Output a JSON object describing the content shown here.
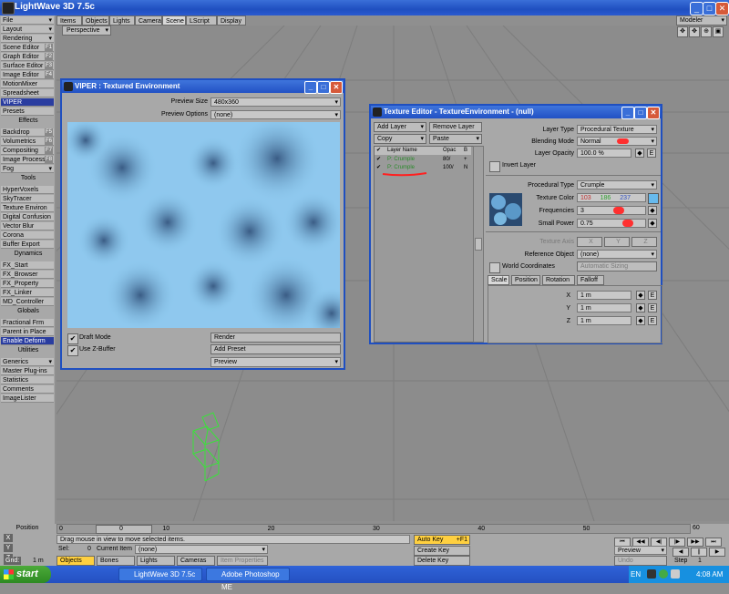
{
  "app": {
    "title": "LightWave 3D 7.5c"
  },
  "left_panel": [
    {
      "label": "File",
      "type": "dd"
    },
    {
      "label": "Layout",
      "type": "dd"
    },
    {
      "label": "Rendering",
      "type": "dd"
    },
    {
      "label": "Scene Editor",
      "sc": "F1"
    },
    {
      "label": "Graph Editor",
      "sc": "F2"
    },
    {
      "label": "Surface Editor",
      "sc": "F3"
    },
    {
      "label": "Image Editor",
      "sc": "F4"
    },
    {
      "label": "MotionMixer"
    },
    {
      "label": "Spreadsheet"
    },
    {
      "label": "VIPER",
      "type": "hl"
    },
    {
      "label": "Presets"
    },
    {
      "label": "Effects",
      "type": "hdr"
    },
    {
      "label": "Backdrop",
      "sc": "F5"
    },
    {
      "label": "Volumetrics",
      "sc": "F6"
    },
    {
      "label": "Compositing",
      "sc": "F7"
    },
    {
      "label": "Image Process",
      "sc": "F8"
    },
    {
      "label": "Fog",
      "type": "dd"
    },
    {
      "label": "Tools",
      "type": "hdr"
    },
    {
      "label": "HyperVoxels"
    },
    {
      "label": "SkyTracer"
    },
    {
      "label": "Texture Environ"
    },
    {
      "label": "Digital Confusion"
    },
    {
      "label": "Vector Blur"
    },
    {
      "label": "Corona"
    },
    {
      "label": "Buffer Export"
    },
    {
      "label": "Dynamics",
      "type": "hdr"
    },
    {
      "label": "FX_Start"
    },
    {
      "label": "FX_Browser"
    },
    {
      "label": "FX_Property"
    },
    {
      "label": "FX_Linker"
    },
    {
      "label": "MD_Controller"
    },
    {
      "label": "Globals",
      "type": "hdr"
    },
    {
      "label": "Fractional Frm"
    },
    {
      "label": "Parent in Place"
    },
    {
      "label": "Enable Deform",
      "type": "hl"
    },
    {
      "label": "Utilities",
      "type": "hdr"
    },
    {
      "label": "Generics",
      "type": "dd"
    },
    {
      "label": "Master Plug-ins"
    },
    {
      "label": "Statistics"
    },
    {
      "label": "Comments"
    },
    {
      "label": "ImageLister"
    }
  ],
  "tabs": [
    "Items",
    "Objects",
    "Lights",
    "Camera",
    "Scene",
    "LScript",
    "Display"
  ],
  "active_tab": "Scene",
  "modeler_label": "Modeler",
  "viewport": {
    "mode": "Perspective"
  },
  "viper": {
    "title": "VIPER : Textured Environment",
    "preview_size_label": "Preview Size",
    "preview_size": "480x360",
    "preview_options_label": "Preview Options",
    "preview_options": "(none)",
    "draft_mode": "Draft Mode",
    "use_zbuffer": "Use Z-Buffer",
    "render": "Render",
    "add_preset": "Add Preset",
    "preview": "Preview"
  },
  "texture_editor": {
    "title": "Texture Editor - TextureEnvironment - (null)",
    "add_layer": "Add Layer",
    "remove_layer": "Remove Layer",
    "copy": "Copy",
    "paste": "Paste",
    "col_layer": "Layer Name",
    "col_opac": "Opac",
    "col_b": "B",
    "layers": [
      {
        "name": "P: Crumple",
        "opac": "80/",
        "b": "+"
      },
      {
        "name": "P: Crumple",
        "opac": "100/",
        "b": "N"
      }
    ],
    "layer_type_label": "Layer Type",
    "layer_type": "Procedural Texture",
    "blending_mode_label": "Blending Mode",
    "blending_mode": "Normal",
    "layer_opacity_label": "Layer Opacity",
    "layer_opacity": "100.0 %",
    "invert_layer": "Invert Layer",
    "procedural_type_label": "Procedural Type",
    "procedural_type": "Crumple",
    "texture_color_label": "Texture Color",
    "color_r": "103",
    "color_g": "186",
    "color_b": "237",
    "frequencies_label": "Frequencies",
    "frequencies": "3",
    "small_power_label": "Small Power",
    "small_power": "0.75",
    "texture_axis_label": "Texture Axis",
    "axis_x": "X",
    "axis_y": "Y",
    "axis_z": "Z",
    "reference_object_label": "Reference Object",
    "reference_object": "(none)",
    "world_coordinates": "World Coordinates",
    "automatic_sizing": "Automatic Sizing",
    "subtabs": [
      "Scale",
      "Position",
      "Rotation",
      "Falloff"
    ],
    "x_label": "X",
    "y_label": "Y",
    "z_label": "Z",
    "x": "1 m",
    "y": "1 m",
    "z": "1 m",
    "e": "E"
  },
  "timeline": {
    "position_label": "Position",
    "start": "0",
    "end": "60",
    "current": "0",
    "ticks": [
      "10",
      "20",
      "30",
      "40",
      "50"
    ],
    "x_label": "X",
    "y_label": "Y",
    "z_label": "Z",
    "status": "Drag mouse in view to move selected items.",
    "grid_label": "Grid:",
    "grid": "1 m",
    "sel_label": "Sel:",
    "sel": "0",
    "current_item_label": "Current Item",
    "current_item": "(none)",
    "objects": "Objects",
    "bones": "Bones",
    "lights": "Lights",
    "cameras": "Cameras",
    "item_properties": "Item Properties",
    "auto_key": "Auto Key",
    "auto_key_sc": "+F1",
    "create_key": "Create Key",
    "delete_key": "Delete Key",
    "preview": "Preview",
    "step_label": "Step",
    "step": "1",
    "undo": "Undo"
  },
  "taskbar": {
    "start": "start",
    "tasks": [
      "LightWave 3D 7.5c",
      "Adobe Photoshop ME"
    ],
    "lang": "EN",
    "time": "4:08 AM"
  }
}
